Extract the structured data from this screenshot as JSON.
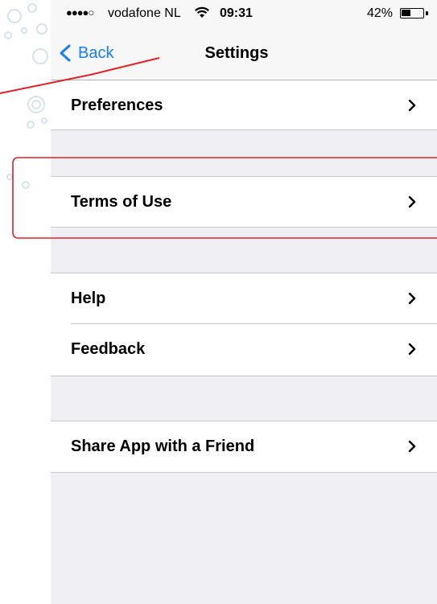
{
  "status_bar": {
    "signal": "●●●●○",
    "carrier": "vodafone NL",
    "time": "09:31",
    "battery_percent": "42%",
    "battery_level": 0.42
  },
  "nav": {
    "back_label": "Back",
    "title": "Settings"
  },
  "rows": [
    {
      "label": "Preferences"
    },
    {
      "label": "Terms of Use"
    },
    {
      "label": "Help"
    },
    {
      "label": "Feedback"
    },
    {
      "label": "Share App with a Friend"
    }
  ],
  "icons": {
    "back": "chevron-left-icon",
    "disclosure": "chevron-right-icon",
    "wifi": "wifi-icon",
    "battery": "battery-icon"
  },
  "colors": {
    "accent": "#157efb",
    "grouped_background": "#efeff4",
    "separator": "#c8c7cc",
    "annotation": "#e0202a"
  }
}
